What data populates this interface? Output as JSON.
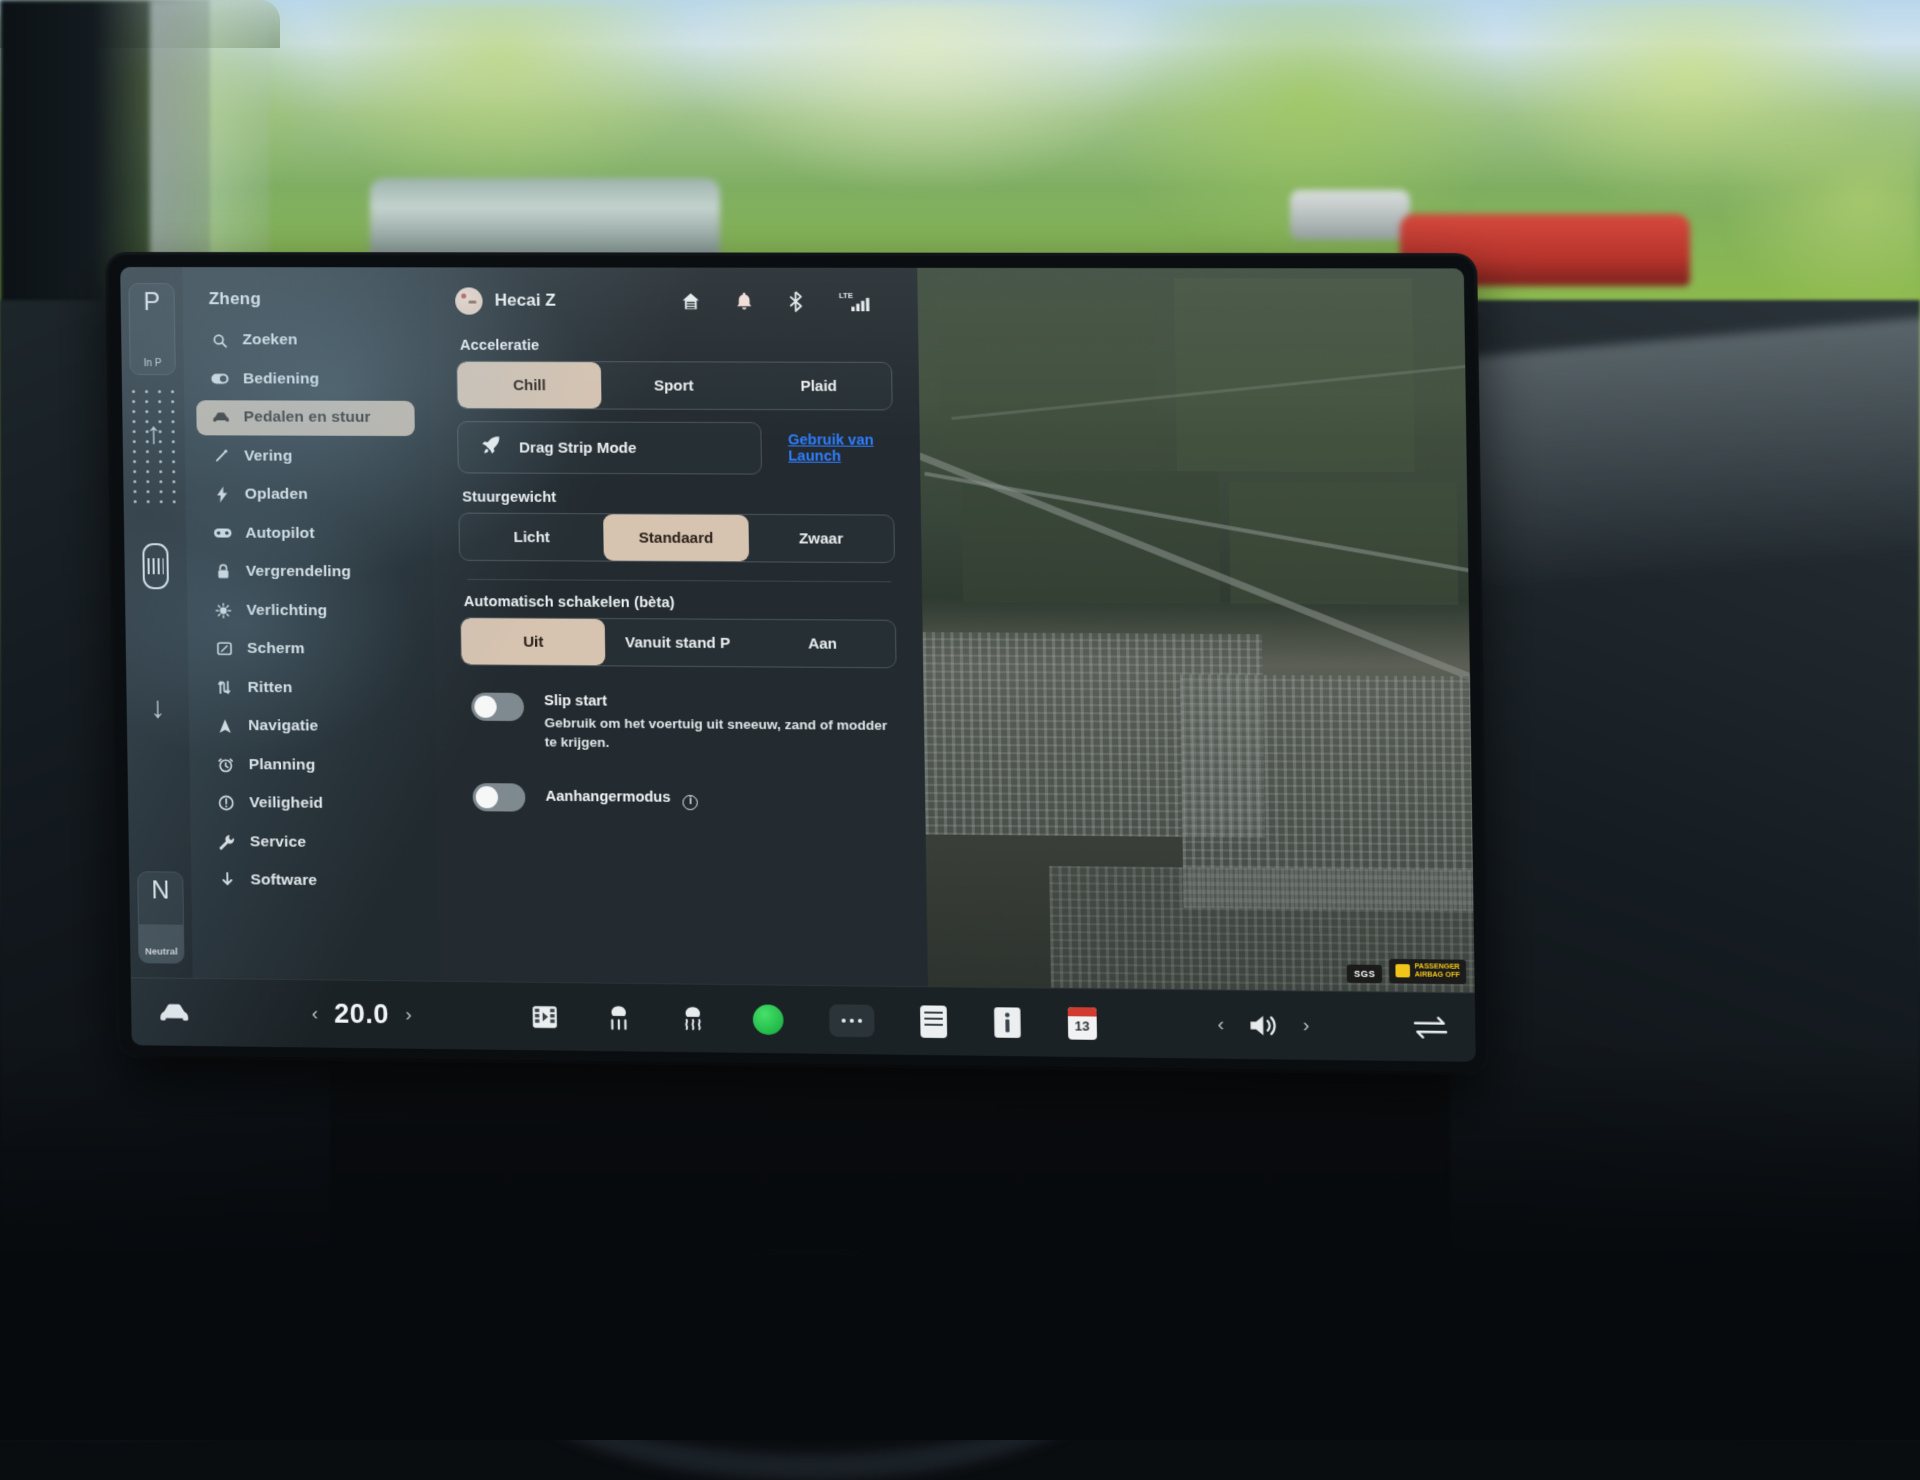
{
  "gear": {
    "top_letter": "P",
    "top_sub": "In P",
    "bottom_letter": "N",
    "bottom_sub": "Neutral"
  },
  "sidebar": {
    "profile_name": "Zheng",
    "items": [
      {
        "label": "Zoeken",
        "icon": "search-icon",
        "active": false
      },
      {
        "label": "Bediening",
        "icon": "toggle-icon",
        "active": false
      },
      {
        "label": "Pedalen en stuur",
        "icon": "car-icon",
        "active": true
      },
      {
        "label": "Vering",
        "icon": "suspension-icon",
        "active": false
      },
      {
        "label": "Opladen",
        "icon": "bolt-icon",
        "active": false
      },
      {
        "label": "Autopilot",
        "icon": "autopilot-icon",
        "active": false
      },
      {
        "label": "Vergrendeling",
        "icon": "lock-icon",
        "active": false
      },
      {
        "label": "Verlichting",
        "icon": "light-icon",
        "active": false
      },
      {
        "label": "Scherm",
        "icon": "display-icon",
        "active": false
      },
      {
        "label": "Ritten",
        "icon": "trips-icon",
        "active": false
      },
      {
        "label": "Navigatie",
        "icon": "navigation-icon",
        "active": false
      },
      {
        "label": "Planning",
        "icon": "schedule-icon",
        "active": false
      },
      {
        "label": "Veiligheid",
        "icon": "safety-icon",
        "active": false
      },
      {
        "label": "Service",
        "icon": "wrench-icon",
        "active": false
      },
      {
        "label": "Software",
        "icon": "download-icon",
        "active": false
      }
    ]
  },
  "topbar": {
    "user_name": "Hecai Z",
    "icons": [
      "home-icon",
      "bell-icon",
      "bluetooth-icon",
      "lte-signal-icon"
    ],
    "lte_label": "LTE"
  },
  "content": {
    "acceleration": {
      "title": "Acceleratie",
      "options": [
        "Chill",
        "Sport",
        "Plaid"
      ],
      "selected": "Chill"
    },
    "drag_strip": {
      "button_label": "Drag Strip Mode",
      "icon": "rocket-icon",
      "link_label": "Gebruik van Launch"
    },
    "steering": {
      "title": "Stuurgewicht",
      "options": [
        "Licht",
        "Standaard",
        "Zwaar"
      ],
      "selected": "Standaard"
    },
    "auto_shift": {
      "title": "Automatisch schakelen (bèta)",
      "options": [
        "Uit",
        "Vanuit stand P",
        "Aan"
      ],
      "selected": "Uit"
    },
    "slip_start": {
      "label": "Slip start",
      "description": "Gebruik om het voertuig uit sneeuw, zand of modder te krijgen.",
      "on": false
    },
    "trailer_mode": {
      "label": "Aanhangermodus",
      "info_glyph": "i",
      "on": false
    }
  },
  "map": {
    "badges": {
      "sgs": "SGS",
      "airbag_line1": "PASSENGER",
      "airbag_line2": "AIRBAG OFF"
    }
  },
  "taskbar": {
    "car_icon": "car-icon",
    "temperature": "20.0",
    "temp_down": "‹",
    "temp_up": "›",
    "center_icons": [
      "media-icon",
      "fan-icon",
      "seat-heater-icon",
      "climate-power-icon",
      "more-icon",
      "card-icon",
      "card-info-icon"
    ],
    "calendar_day": "13",
    "volume_down": "‹",
    "volume_up": "›",
    "volume_icon": "volume-icon",
    "swap_icon": "swap-icon"
  }
}
